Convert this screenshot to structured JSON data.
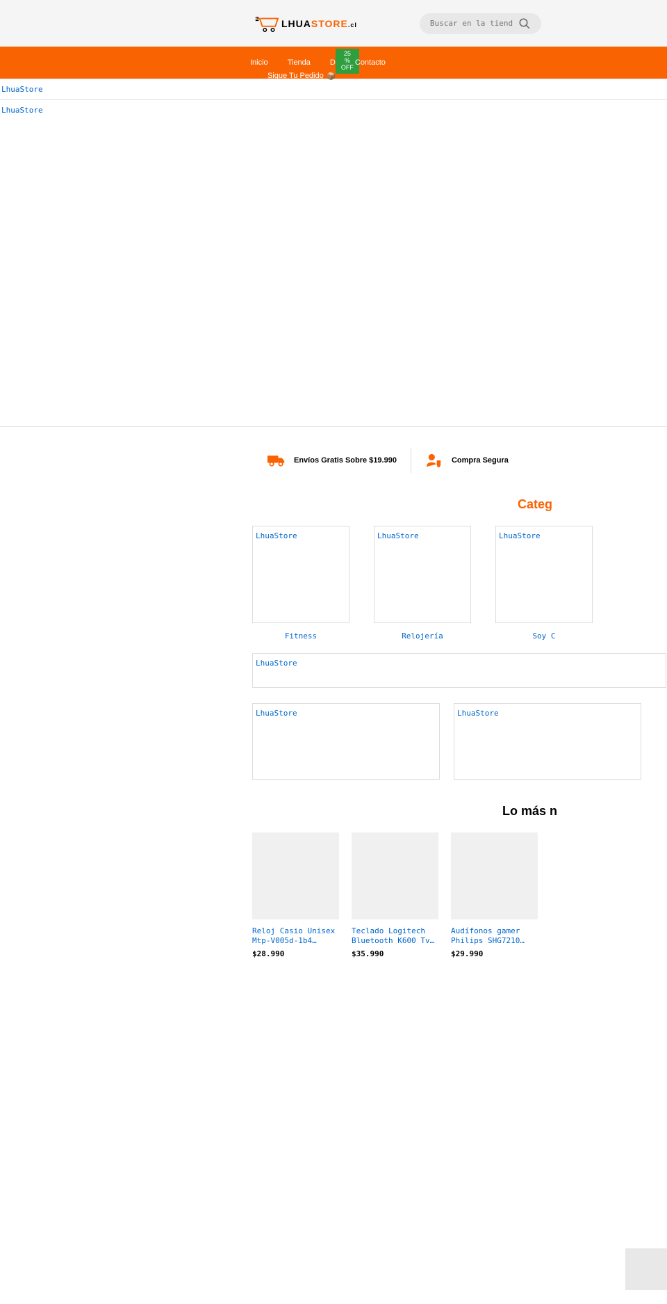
{
  "header": {
    "logo_lhua": "LHUA",
    "logo_store": "STORE",
    "logo_suffix": ".cl",
    "search_placeholder": "Buscar en la tiend"
  },
  "nav": {
    "items": [
      {
        "label": "Inicio"
      },
      {
        "label": "Tienda"
      },
      {
        "label": "D"
      },
      {
        "label": "Contacto"
      }
    ],
    "promo_badge": "25 %\nOFF",
    "track_label": "Sigue Tu Pedido"
  },
  "banners": {
    "banner1_alt": "LhuaStore",
    "banner2_alt": "LhuaStore"
  },
  "features": [
    {
      "icon": "truck",
      "label": "Envíos Gratis Sobre $19.990"
    },
    {
      "icon": "user-shield",
      "label": "Compra Segura"
    }
  ],
  "categories_title": "Categ",
  "categories": [
    {
      "alt": "LhuaStore",
      "name": "Fitness"
    },
    {
      "alt": "LhuaStore",
      "name": "Relojería"
    },
    {
      "alt": "LhuaStore",
      "name": "Soy C"
    }
  ],
  "promo_banners": {
    "wide_alt": "LhuaStore",
    "half1_alt": "LhuaStore",
    "half2_alt": "LhuaStore"
  },
  "products_title": "Lo más n",
  "products": [
    {
      "title": "Reloj Casio Unisex Mtp-V005d-1b4…",
      "price": "$28.990"
    },
    {
      "title": "Teclado Logitech Bluetooth K600 Tv…",
      "price": "$35.990"
    },
    {
      "title": "Audífonos gamer Philips SHG7210…",
      "price": "$29.990"
    }
  ]
}
